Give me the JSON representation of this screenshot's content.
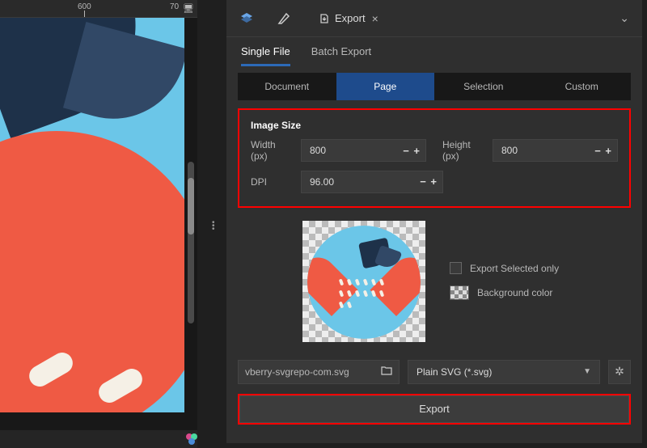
{
  "ruler": {
    "mark600": "600",
    "mark700": "70"
  },
  "toolTabs": {
    "exportLabel": "Export"
  },
  "modeTabs": {
    "single": "Single File",
    "batch": "Batch Export"
  },
  "scopeTabs": {
    "document": "Document",
    "page": "Page",
    "selection": "Selection",
    "custom": "Custom"
  },
  "imageSize": {
    "title": "Image Size",
    "widthLabel": "Width (px)",
    "width": "800",
    "heightLabel": "Height (px)",
    "height": "800",
    "dpiLabel": "DPI",
    "dpi": "96.00"
  },
  "options": {
    "exportSelected": "Export Selected only",
    "backgroundColor": "Background color"
  },
  "file": {
    "name": "vberry-svgrepo-com.svg",
    "format": "Plain SVG (*.svg)"
  },
  "exportButton": "Export"
}
